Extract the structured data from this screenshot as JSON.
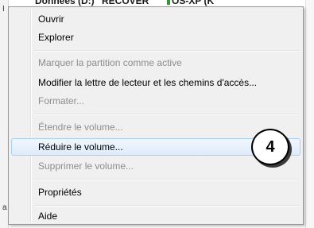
{
  "background": {
    "col1": "Données (D:)",
    "col2": "RECOVER",
    "col3": "OS-XP (K",
    "left_chars": [
      "I",
      "a"
    ]
  },
  "menu": {
    "items": [
      {
        "label": "Ouvrir",
        "enabled": true
      },
      {
        "label": "Explorer",
        "enabled": true
      },
      {
        "label": "Marquer la partition comme active",
        "enabled": false
      },
      {
        "label": "Modifier la lettre de lecteur et les chemins d'accès...",
        "enabled": true
      },
      {
        "label": "Formater...",
        "enabled": false
      },
      {
        "label": "Étendre le volume...",
        "enabled": false
      },
      {
        "label": "Réduire le volume...",
        "enabled": true,
        "highlighted": true
      },
      {
        "label": "Supprimer le volume...",
        "enabled": false
      },
      {
        "label": "Propriétés",
        "enabled": true
      },
      {
        "label": "Aide",
        "enabled": true
      }
    ]
  },
  "callout": {
    "step": "4"
  },
  "colors": {
    "menu_bg": "#f0f0f0",
    "highlight_border": "#a8d1f8",
    "disabled_text": "#8d8d8d"
  }
}
